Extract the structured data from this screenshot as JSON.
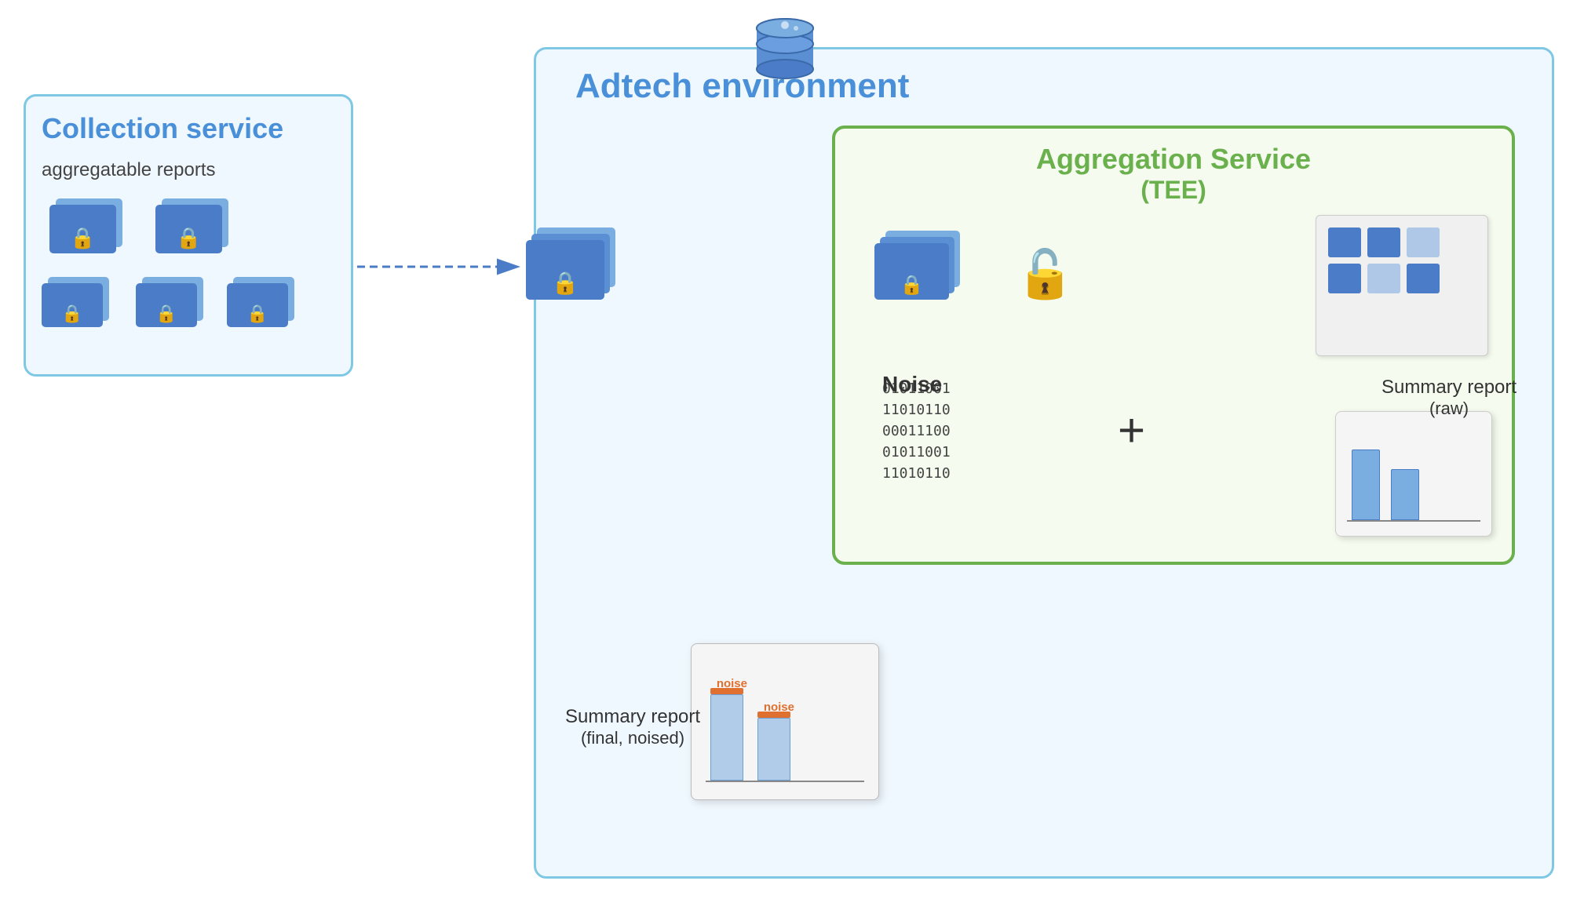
{
  "adtech": {
    "env_label": "Adtech environment",
    "border_color": "#7EC8E3"
  },
  "collection_service": {
    "label": "Collection service",
    "sub_label": "aggregatable reports"
  },
  "aggregation_service": {
    "label": "Aggregation Service",
    "sub_label": "(TEE)"
  },
  "noise": {
    "label": "Noise",
    "binary": [
      "01011001",
      "11010110",
      "00011100",
      "01011001",
      "11010110"
    ]
  },
  "summary_report_raw": {
    "label": "Summary report",
    "sub_label": "(raw)"
  },
  "summary_report_final": {
    "label": "Summary report",
    "sub_label": "(final, noised)"
  },
  "noise_bar_label": "noise",
  "colors": {
    "blue_dark": "#4a7cc7",
    "blue_light": "#7aaee0",
    "green_border": "#6ab04c",
    "adtech_blue": "#4a90d9",
    "orange": "#e07030"
  }
}
